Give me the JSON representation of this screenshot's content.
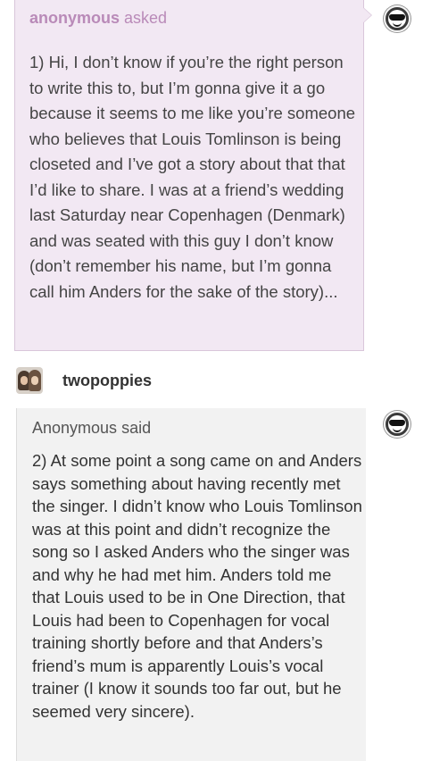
{
  "ask": {
    "asker": "anonymous",
    "verb": "asked",
    "body": "1) Hi, I don’t know if you’re the right person to write this to, but I’m gonna give it a go because it seems to me like you’re someone who believes that Louis Tomlinson is being closeted and I’ve got a story about that that I’d like to share. I was at a friend’s wedding last Saturday near Copenhagen (Denmark) and was seated with this guy I don’t know (don’t remember his name, but I’m gonna call him Anders for the sake of the story)..."
  },
  "reblog": {
    "username": "twopoppies"
  },
  "quote": {
    "author": "Anonymous",
    "verb": "said",
    "body": "2) At some point a song came on and Anders says something about having recently met the singer. I didn’t know who Louis Tomlinson was at this point and didn’t recognize the song so I asked Anders who the singer was and why he had met him. Anders told me that Louis used to be in One Direction, that Louis had been to Copenhagen for vocal training shortly before and that Anders’s friend’s mum is apparently Louis’s vocal trainer (I know it sounds too far out, but he seemed very sincere)."
  },
  "icons": {
    "answerer_avatar": "sunglasses-avatar-icon",
    "reblogger_avatar": "user-avatar-photo"
  },
  "colors": {
    "ask_background": "#f2e8f3",
    "ask_name": "#b98ab8",
    "quote_background": "#f2f2f2"
  }
}
